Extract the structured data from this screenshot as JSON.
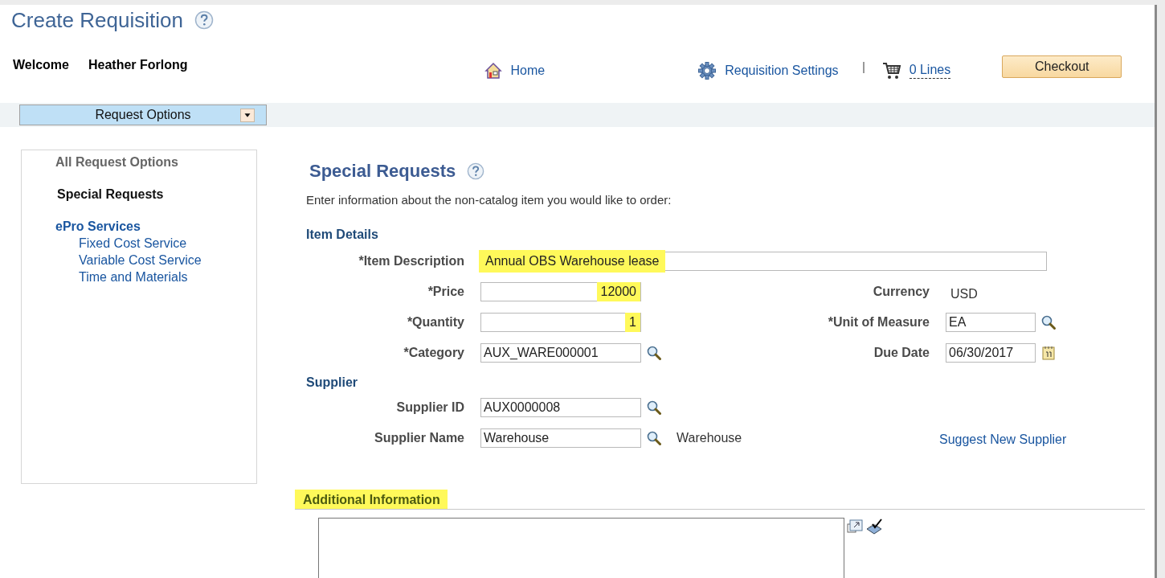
{
  "page_title": "Create Requisition",
  "welcome": {
    "label": "Welcome",
    "user": "Heather Forlong"
  },
  "nav": [
    {
      "kind": "home",
      "label": "Home"
    },
    {
      "kind": "settings",
      "label": "Requisition Settings"
    },
    {
      "kind": "cart",
      "label": "0 Lines"
    }
  ],
  "checkout_button": "Checkout",
  "request_options": "Request Options",
  "sidebar": {
    "items": [
      {
        "label": "All Request Options",
        "kind": "heading"
      },
      {
        "label": "Special Requests",
        "kind": "current"
      },
      {
        "label": "ePro Services",
        "kind": "link",
        "children": [
          {
            "label": "Fixed Cost Service"
          },
          {
            "label": "Variable Cost Service"
          },
          {
            "label": "Time and Materials"
          }
        ]
      }
    ]
  },
  "section_title": "Special Requests",
  "instructions": "Enter information about the non-catalog item you would like to order:",
  "groups": [
    {
      "title": "Item Details",
      "rows": [
        {
          "left": {
            "label": "*Item Description",
            "value": "Annual OBS Warehouse lease",
            "kind": "wide",
            "highlighted": true
          }
        },
        {
          "left": {
            "label": "*Price",
            "value": "12000",
            "kind": "number",
            "highlighted": true
          },
          "right": {
            "label": "Currency",
            "value": "USD",
            "kind": "readonly",
            "highlighted": false
          }
        },
        {
          "left": {
            "label": "*Quantity",
            "value": "1",
            "kind": "number",
            "highlighted": true
          },
          "right": {
            "label": "*Unit of Measure",
            "value": "EA",
            "kind": "lookup",
            "highlighted": false
          }
        },
        {
          "left": {
            "label": "*Category",
            "value": "AUX_WARE000001",
            "kind": "lookup",
            "highlighted": false
          },
          "right": {
            "label": "Due Date",
            "value": "06/30/2017",
            "kind": "date",
            "highlighted": false
          }
        }
      ]
    },
    {
      "title": "Supplier",
      "rows": [
        {
          "left": {
            "label": "Supplier ID",
            "value": "AUX0000008",
            "kind": "lookup",
            "highlighted": false
          }
        },
        {
          "left": {
            "label": "Supplier Name",
            "value": "Warehouse",
            "kind": "lookup",
            "note": "Warehouse",
            "highlighted": false
          },
          "right": {
            "value": "Suggest New Supplier",
            "kind": "link",
            "highlighted": false
          }
        }
      ]
    }
  ],
  "additional_info": {
    "title": "Additional Information",
    "highlighted": true
  }
}
